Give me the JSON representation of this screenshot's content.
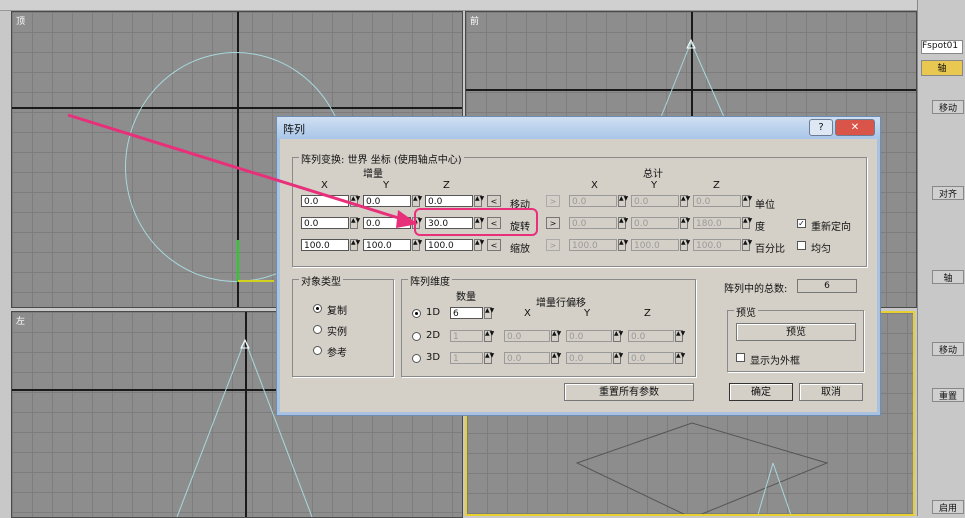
{
  "viewports": {
    "top_label": "顶",
    "front_label": "前",
    "left_label": "左"
  },
  "right_panel": {
    "object_name": "Fspot01",
    "tab": "轴",
    "items": [
      "移动",
      "对齐",
      "轴",
      "移动",
      "重置",
      "启用"
    ]
  },
  "dialog": {
    "title": "阵列",
    "help_btn": "?",
    "close_btn": "✕",
    "transform_group": "阵列变换: 世界 坐标 (使用轴点中心)",
    "increment_label": "增量",
    "total_label": "总计",
    "axis_x": "X",
    "axis_y": "Y",
    "axis_z": "Z",
    "rows": [
      {
        "name": "移动",
        "inc": [
          "0.0",
          "0.0",
          "0.0"
        ],
        "total": [
          "0.0",
          "0.0",
          "0.0"
        ],
        "unit": "单位"
      },
      {
        "name": "旋转",
        "inc": [
          "0.0",
          "0.0",
          "30.0"
        ],
        "total": [
          "0.0",
          "0.0",
          "180.0"
        ],
        "unit": "度"
      },
      {
        "name": "缩放",
        "inc": [
          "100.0",
          "100.0",
          "100.0"
        ],
        "total": [
          "100.0",
          "100.0",
          "100.0"
        ],
        "unit": "百分比"
      }
    ],
    "reorient": "重新定向",
    "uniform": "均匀",
    "object_type": {
      "group": "对象类型",
      "options": [
        "复制",
        "实例",
        "参考"
      ],
      "selected": 0
    },
    "dimensions": {
      "group": "阵列维度",
      "count_label": "数量",
      "offset_label": "增量行偏移",
      "rows": [
        {
          "name": "1D",
          "count": "6",
          "offset": [],
          "checked": true
        },
        {
          "name": "2D",
          "count": "1",
          "offset": [
            "0.0",
            "0.0",
            "0.0"
          ],
          "checked": false
        },
        {
          "name": "3D",
          "count": "1",
          "offset": [
            "0.0",
            "0.0",
            "0.0"
          ],
          "checked": false
        }
      ]
    },
    "total_count_label": "阵列中的总数:",
    "total_count": "6",
    "preview": {
      "group": "预览",
      "button": "预览",
      "show_as_box": "显示为外框"
    },
    "reset_button": "重置所有参数",
    "ok_button": "确定",
    "cancel_button": "取消"
  }
}
